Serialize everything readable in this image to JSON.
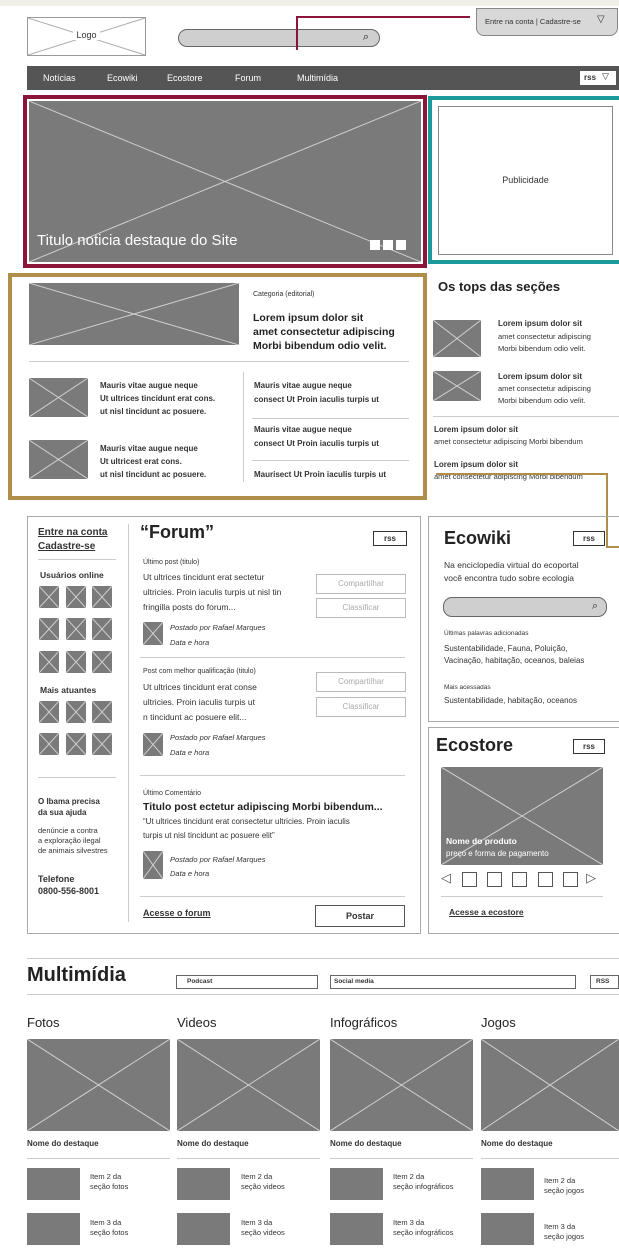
{
  "header": {
    "logo": "Logo",
    "login": "Entre na conta | Cadastre-se"
  },
  "nav": {
    "items": [
      "Notícias",
      "Ecowiki",
      "Ecostore",
      "Forum",
      "Multimídia"
    ],
    "rss": "rss"
  },
  "hero": {
    "title": "Titulo noticia destaque do Site"
  },
  "ad": {
    "label": "Publicidade"
  },
  "news": {
    "category": "Categoria (editorial)",
    "headline": [
      "Lorem ipsum dolor sit",
      "amet consectetur adipiscing",
      "Morbi bibendum odio velit."
    ],
    "items": [
      [
        "Mauris vitae augue neque",
        "Ut ultrices tincidunt erat cons.",
        "ut nisl tincidunt ac posuere."
      ],
      [
        "Mauris vitae augue neque",
        "Ut ultricest erat cons.",
        "ut nisl tincidunt ac posuere."
      ]
    ],
    "right_items": [
      [
        "Mauris vitae augue neque",
        "consect Ut Proin iaculis turpis ut"
      ],
      [
        "Mauris vitae augue neque",
        "consect Ut Proin iaculis turpis ut"
      ],
      [
        "Maurisect Ut Proin iaculis turpis ut"
      ]
    ]
  },
  "tops": {
    "title": "Os tops das seções",
    "items": [
      [
        "Lorem ipsum dolor sit",
        "amet consectetur adipiscing",
        "Morbi bibendum odio velit."
      ],
      [
        "Lorem ipsum dolor sit",
        "amet consectetur adipiscing",
        "Morbi bibendum odio velit."
      ]
    ],
    "text_items": [
      [
        "Lorem ipsum dolor sit",
        "amet consectetur adipiscing Morbi bibendum"
      ],
      [
        "Lorem ipsum dolor sit",
        "amet consectetur adipiscing Morbi bibendum"
      ]
    ]
  },
  "side": {
    "login": "Entre na conta",
    "signup": "Cadastre-se",
    "online": "Usuários online",
    "active": "Mais atuantes",
    "ibama_title": [
      "O Ibama precisa",
      "da sua ajuda"
    ],
    "ibama_text": [
      "denúncie a contra",
      "a exploração ilegal",
      "de animais silvestres"
    ],
    "phone_label": "Telefone",
    "phone": "0800-556-8001"
  },
  "forum": {
    "title": "“Forum”",
    "rss": "rss",
    "post1": {
      "label": "Último post (titulo)",
      "text": [
        "Ut ultrices tincidunt erat sectetur",
        "ultricies. Proin iaculis turpis ut nisl tin",
        "fringilla posts do forum..."
      ],
      "by": "Postado por Rafael Marques",
      "date": "Data e hora"
    },
    "post2": {
      "label": "Post com melhor qualificação (titulo)",
      "text": [
        "Ut ultrices tincidunt erat conse",
        "ultricies. Proin iaculis turpis ut",
        "n tincidunt ac posuere elit..."
      ],
      "by": "Postado por Rafael Marques",
      "date": "Data e hora"
    },
    "share": "Compartilhar",
    "rate": "Classificar",
    "comment": {
      "label": "Último Comentário",
      "title": "Titulo post ectetur adipiscing Morbi bibendum...",
      "text": [
        "“Ut ultrices tincidunt erat consectetur ultricies. Proin iaculis",
        "turpis ut nisl tincidunt ac posuere elit”"
      ],
      "by": "Postado por Rafael Marques",
      "date": "Data e hora"
    },
    "link": "Acesse o forum",
    "post_btn": "Postar"
  },
  "ecowiki": {
    "title": "Ecowiki",
    "rss": "rss",
    "desc": [
      "Na enciclopedia virtual do ecoportal",
      "você encontra tudo sobre ecologia"
    ],
    "recent_label": "Últimas palavras adicionadas",
    "recent": [
      "Sustentabilidade, Fauna, Poluição,",
      "Vacinação, habitação, oceanos, baleias"
    ],
    "top_label": "Mais acessadas",
    "top": "Sustentabilidade, habitação, oceanos"
  },
  "ecostore": {
    "title": "Ecostore",
    "rss": "rss",
    "product": "Nome do produto",
    "price": "preço e forma de pagamento",
    "link": "Acesse a ecostore"
  },
  "multimedia": {
    "title": "Multimídia",
    "tab1": "Podcast",
    "tab2": "Social media",
    "rss": "RSS",
    "columns": [
      {
        "title": "Fotos",
        "featured": "Nome do destaque",
        "item2": [
          "Item 2 da",
          "seção fotos"
        ],
        "item3": [
          "Item 3 da",
          "seção fotos"
        ]
      },
      {
        "title": "Videos",
        "featured": "Nome do destaque",
        "item2": [
          "Item 2 da",
          "seção videos"
        ],
        "item3": [
          "Item 3 da",
          "seção videos"
        ]
      },
      {
        "title": "Infográficos",
        "featured": "Nome do destaque",
        "item2": [
          "Item 2 da",
          "seção infográficos"
        ],
        "item3": [
          "Item 3 da",
          "seção infográficos"
        ]
      },
      {
        "title": "Jogos",
        "featured": "Nome do destaque",
        "item2": [
          "Item 2 da",
          "seção jogos"
        ],
        "item3": [
          "Item 3 da",
          "seção jogos"
        ]
      }
    ]
  },
  "colors": {
    "hero_border": "#8b1538",
    "ad_border": "#1a9a9a",
    "news_border": "#b08d4a",
    "nav_bg": "#555555"
  }
}
